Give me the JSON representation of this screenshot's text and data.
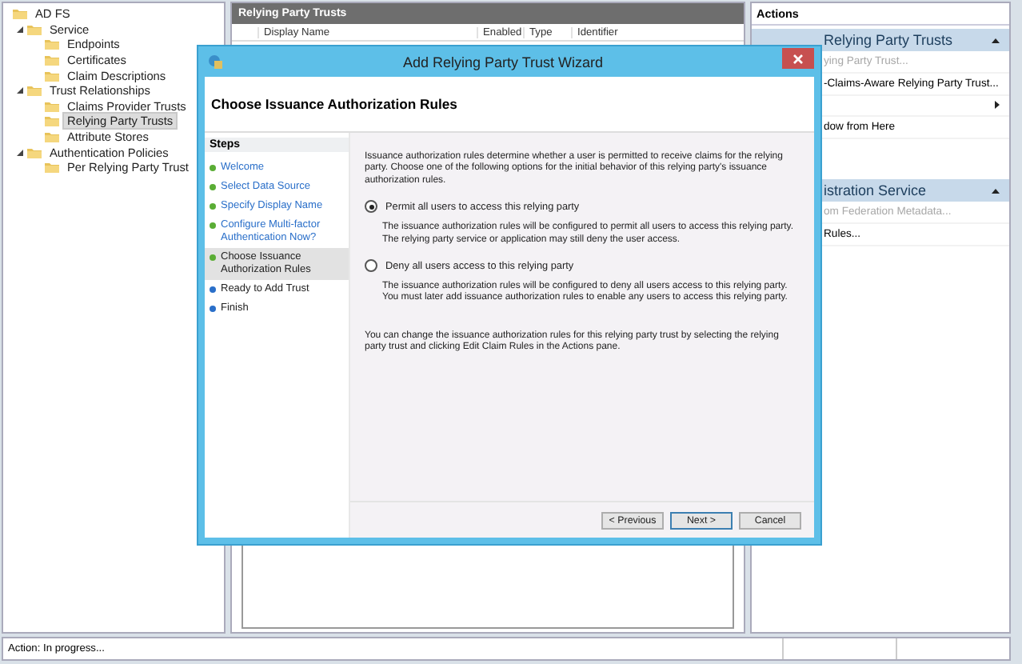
{
  "tree": [
    {
      "label": "AD FS",
      "selected": false,
      "children": [
        {
          "label": "Service",
          "selected": false,
          "expanded": true,
          "children": [
            {
              "label": "Endpoints",
              "selected": false
            },
            {
              "label": "Certificates",
              "selected": false
            },
            {
              "label": "Claim Descriptions",
              "selected": false
            }
          ]
        },
        {
          "label": "Trust Relationships",
          "selected": false,
          "expanded": true,
          "children": [
            {
              "label": "Claims Provider Trusts",
              "selected": false
            },
            {
              "label": "Relying Party Trusts",
              "selected": true
            },
            {
              "label": "Attribute Stores",
              "selected": false
            }
          ]
        },
        {
          "label": "Authentication Policies",
          "selected": false,
          "expanded": true,
          "children": [
            {
              "label": "Per Relying Party Trust",
              "selected": false
            }
          ]
        }
      ]
    }
  ],
  "main_pane": {
    "title": "Relying Party Trusts",
    "columns": [
      "Display Name",
      "Enabled",
      "Type",
      "Identifier"
    ]
  },
  "actions": {
    "title": "Actions",
    "sections": [
      {
        "title": "Relying Party Trusts",
        "items": [
          {
            "kind": "action",
            "label": "ying Party Trust...",
            "disabled": true
          },
          {
            "kind": "action",
            "label": "-Claims-Aware Relying Party Trust...",
            "disabled": false
          },
          {
            "kind": "submenu"
          },
          {
            "kind": "action",
            "label": "dow from Here",
            "disabled": false
          }
        ]
      },
      {
        "title": "istration Service",
        "items": [
          {
            "kind": "action",
            "label": "om Federation Metadata...",
            "disabled": true
          },
          {
            "kind": "action",
            "label": "Rules...",
            "disabled": false
          }
        ]
      }
    ]
  },
  "status_bar": {
    "text": "Action:  In progress..."
  },
  "wizard": {
    "title": "Add Relying Party Trust Wizard",
    "heading": "Choose Issuance Authorization Rules",
    "steps_title": "Steps",
    "steps": [
      {
        "label": "Welcome",
        "kind": "done",
        "selected": false
      },
      {
        "label": "Select Data Source",
        "kind": "done",
        "selected": false
      },
      {
        "label": "Specify Display Name",
        "kind": "done",
        "selected": false
      },
      {
        "label": "Configure Multi-factor Authentication Now?",
        "kind": "done",
        "selected": false
      },
      {
        "label": "Choose Issuance Authorization Rules",
        "kind": "current",
        "selected": true
      },
      {
        "label": "Ready to Add Trust",
        "kind": "pending",
        "selected": false
      },
      {
        "label": "Finish",
        "kind": "pending",
        "selected": false
      }
    ],
    "intro": "Issuance authorization rules determine whether a user is permitted to receive claims for the relying party. Choose one of the following options for the initial behavior of this relying party's issuance authorization rules.",
    "options": [
      {
        "label": "Permit all users to access this relying party",
        "selected": true,
        "description": "The issuance authorization rules will be configured to permit all users to access this relying party. The relying party service or application may still deny the user access."
      },
      {
        "label": "Deny all users access to this relying party",
        "selected": false,
        "description": "The issuance authorization rules will be configured to deny all users access to this relying party. You must later add issuance authorization rules to enable any users to access this relying party."
      }
    ],
    "note": "You can change the issuance authorization rules for this relying party trust by selecting the relying party trust and clicking Edit Claim Rules in the Actions pane.",
    "buttons": [
      {
        "label": "< Previous",
        "kind": "normal"
      },
      {
        "label": "Next >",
        "kind": "default"
      },
      {
        "label": "Cancel",
        "kind": "normal"
      }
    ]
  }
}
